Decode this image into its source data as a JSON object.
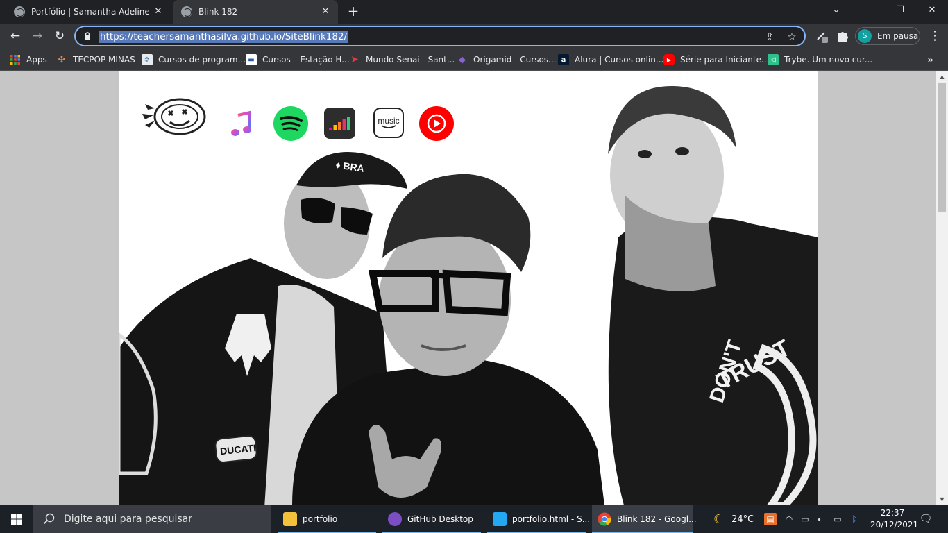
{
  "tabs": [
    {
      "title": "Portfólio | Samantha Adeline - De",
      "active": false
    },
    {
      "title": "Blink 182",
      "active": true
    }
  ],
  "window_controls": {
    "tab_search": "⌄",
    "minimize": "—",
    "restore": "❐",
    "close": "✕"
  },
  "toolbar": {
    "back": "←",
    "forward": "→",
    "reload": "↻",
    "url": "https://teachersamanthasilva.github.io/SiteBlink182/",
    "profile_initial": "S",
    "profile_status": "Em pausa"
  },
  "bookmarks": [
    {
      "label": "Apps",
      "icon": "apps-grid-icon"
    },
    {
      "label": "TECPOP MINAS",
      "icon": "tecpop-icon"
    },
    {
      "label": "Cursos de program...",
      "icon": "cursos-icon"
    },
    {
      "label": "Cursos – Estação H...",
      "icon": "estacao-icon"
    },
    {
      "label": "Mundo Senai - Sant...",
      "icon": "senai-icon"
    },
    {
      "label": "Origamid - Cursos...",
      "icon": "origamid-icon"
    },
    {
      "label": "Alura | Cursos onlin...",
      "icon": "alura-icon"
    },
    {
      "label": "Série para Iniciante...",
      "icon": "youtube-icon"
    },
    {
      "label": "Trybe. Um novo cur...",
      "icon": "trybe-icon"
    }
  ],
  "bookmarks_overflow": "»",
  "page": {
    "services": [
      "apple-music-icon",
      "spotify-icon",
      "deezer-icon",
      "amazon-music-icon",
      "youtube-music-icon"
    ],
    "amazon_label": "music",
    "shirt_text_1": "DON'T",
    "shirt_text_2": "TRUST",
    "patch_text": "DUCATI",
    "cap_text": "♦ BRA"
  },
  "taskbar": {
    "search_placeholder": "Digite aqui para pesquisar",
    "apps": [
      {
        "label": "portfolio",
        "active": false
      },
      {
        "label": "GitHub Desktop",
        "active": false
      },
      {
        "label": "portfolio.html - S...",
        "active": false
      },
      {
        "label": "Blink 182 - Googl...",
        "active": true
      }
    ],
    "weather": "24°C",
    "time": "22:37",
    "date": "20/12/2021"
  },
  "colors": {
    "accent": "#8ab4f8",
    "spotify": "#1ed760",
    "youtube": "#ff0000",
    "deezer": "#2d2d2d"
  }
}
